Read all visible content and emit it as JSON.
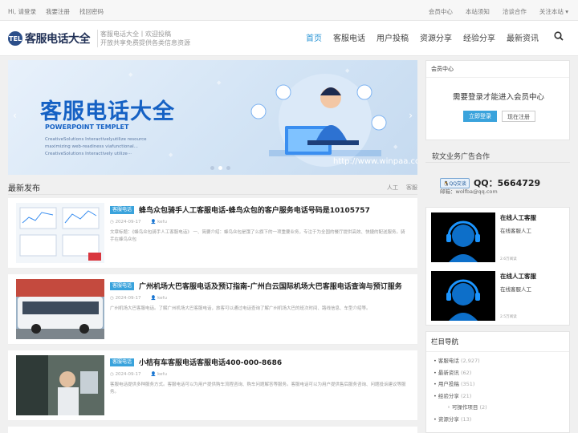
{
  "topbar": {
    "greeting": "Hi, 请登录",
    "register": "我要注册",
    "forgot": "找回密码",
    "links": [
      "会员中心",
      "本站须知",
      "洽谈合作",
      "关注本站 ▾"
    ]
  },
  "header": {
    "logo_mark": "TEL",
    "logo_text": "客服电话大全",
    "slogan_line1": "客服电话大全丨欢迎投稿",
    "slogan_line2": "开放共享免费提供各类信息资源",
    "nav": [
      "首页",
      "客服电话",
      "用户投稿",
      "资源分享",
      "经验分享",
      "最新资讯"
    ]
  },
  "banner": {
    "title": "客服电话大全",
    "subtitle": "POWERPOINT TEMPLET",
    "desc": "CreativeSolutions Interactivelyutilize resource maximizing web-readiness viafunctional... CreativeSolutions Interactively utilize···",
    "url": "http://www.winpaa.com",
    "prev": "‹",
    "next": "›",
    "active_slide": 2,
    "slides": 3
  },
  "latest": {
    "title": "最新发布",
    "tags": [
      "人工",
      "客服"
    ]
  },
  "posts": [
    {
      "category": "客服电话",
      "title": "蜂鸟众包骑手人工客服电话-蜂鸟众包的客户服务电话号码是10105757",
      "date": "2024-09-17",
      "author": "kefu",
      "summary": "文章标题：《蜂鸟众包骑手人工客服电话》 一、简要介绍：蜂鸟众包是饿了么旗下的一项重要业务，专注于为全国的餐厅提供高效、快捷的配送服务。骑手在蜂鸟众包"
    },
    {
      "category": "客服电话",
      "title": "广州机场大巴客服电话及预订指南-广州白云国际机场大巴客服电话查询与预订服务",
      "date": "2024-09-17",
      "author": "kefu",
      "summary": "广州机场大巴客服电话。了解广州机场大巴客服电话，旅客可以通过电话查询了解广州机场大巴的班次时间、路线信息、车型介绍等。"
    },
    {
      "category": "客服电话",
      "title": "小桔有车客服电话客服电话400-000-8686",
      "date": "2024-09-17",
      "author": "kefu",
      "summary": "客服电话提供多种服务方式。客服电话可以为用户提供购车流程咨询、购车问题解答等服务。客服电话可以为用户提供售后服务咨询、问题投诉建议等服务。"
    }
  ],
  "member": {
    "title": "会员中心",
    "prompt": "需要登录才能进入会员中心",
    "login": "立即登录",
    "register": "现在注册"
  },
  "ad": {
    "title": "软文业务广告合作",
    "qq_badge": "QQ交谈",
    "qq": "QQ：5664729",
    "email": "邮箱：wolfba@qq.com"
  },
  "service": [
    {
      "title": "在线人工客服",
      "desc": "在线客服人工",
      "meta": "2.6万阅读"
    },
    {
      "title": "在线人工客服",
      "desc": "在线客服人工",
      "meta": "2.5万阅读"
    }
  ],
  "columns": {
    "title": "栏目导航",
    "items": [
      {
        "name": "客服电话",
        "count": "(2,927)"
      },
      {
        "name": "最新资讯",
        "count": "(62)"
      },
      {
        "name": "用户投稿",
        "count": "(351)"
      },
      {
        "name": "经验分享",
        "count": "(21)"
      },
      {
        "name": "可操作项目",
        "count": "(2)"
      },
      {
        "name": "资源分享",
        "count": "(13)"
      }
    ]
  },
  "colors": {
    "accent": "#2c96d6",
    "brand": "#1f2f55",
    "banner_title": "#1561c4"
  },
  "icons": [
    "search-icon",
    "user-icon",
    "qq-icon",
    "headset-icon"
  ]
}
